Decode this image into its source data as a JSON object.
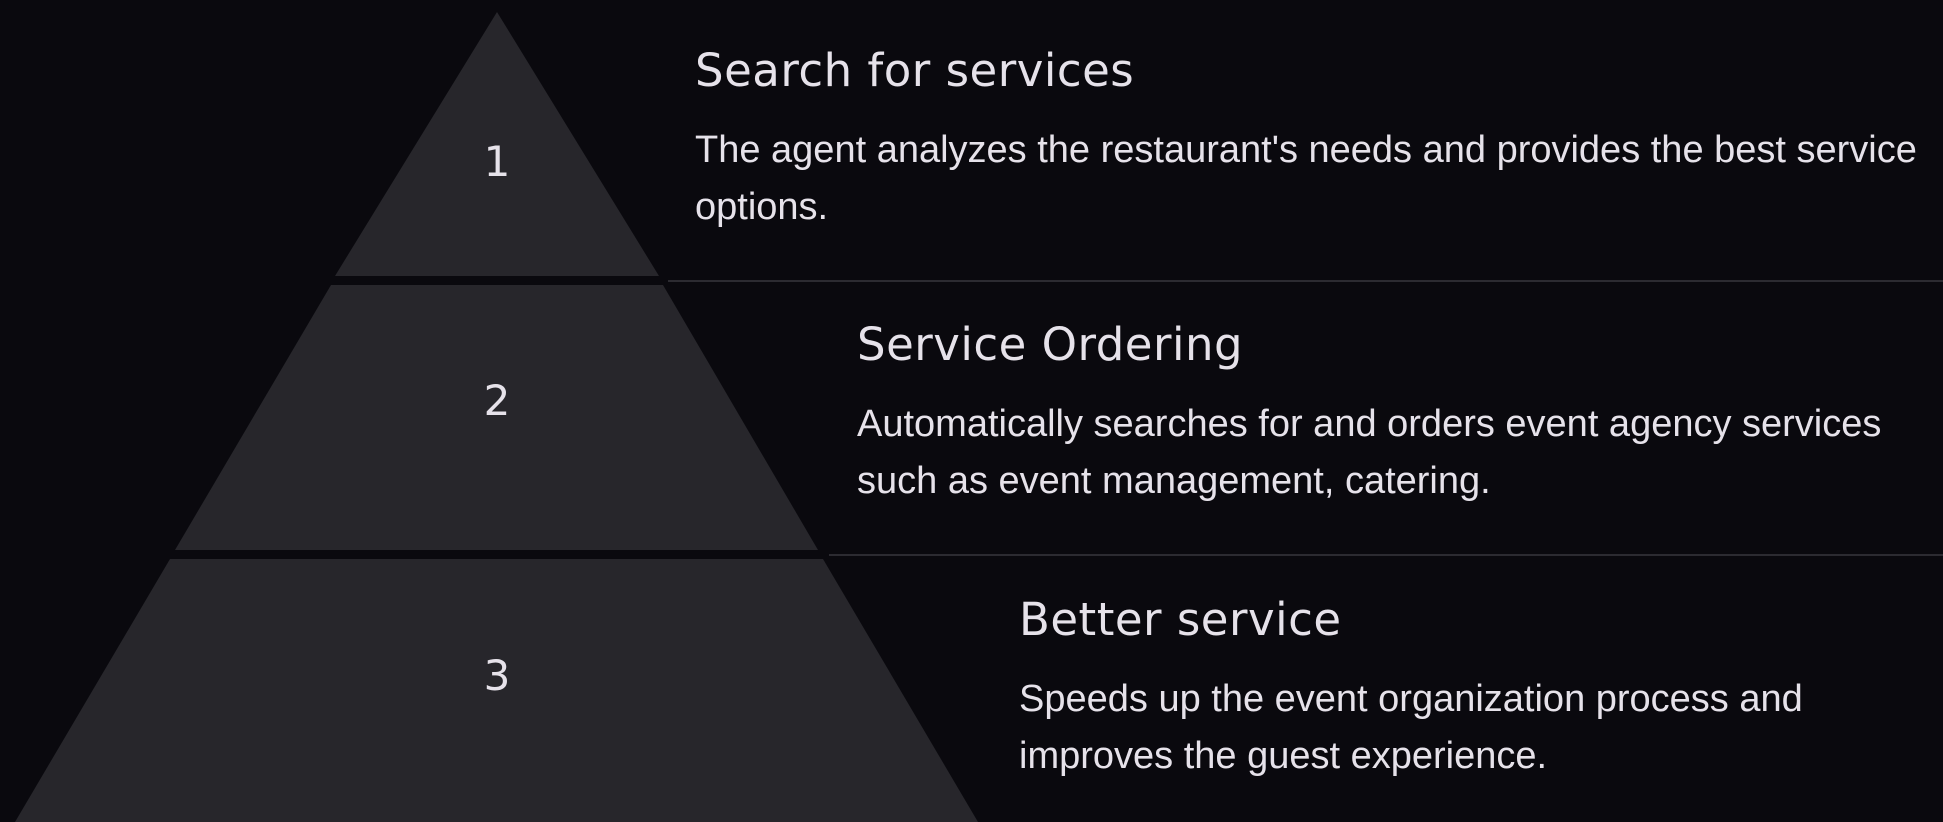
{
  "colors": {
    "background": "#0a090e",
    "tier_fill": "#27262b",
    "divider": "#2c2b31",
    "text": "#e6e2ea"
  },
  "steps": [
    {
      "number": "1",
      "title": "Search for services",
      "description": "The agent analyzes the restaurant's needs and provides the best service options."
    },
    {
      "number": "2",
      "title": "Service Ordering",
      "description": "Automatically searches for and orders event agency services such as event management, catering."
    },
    {
      "number": "3",
      "title": "Better service",
      "description": "Speeds up the event organization process and improves the guest experience."
    }
  ]
}
